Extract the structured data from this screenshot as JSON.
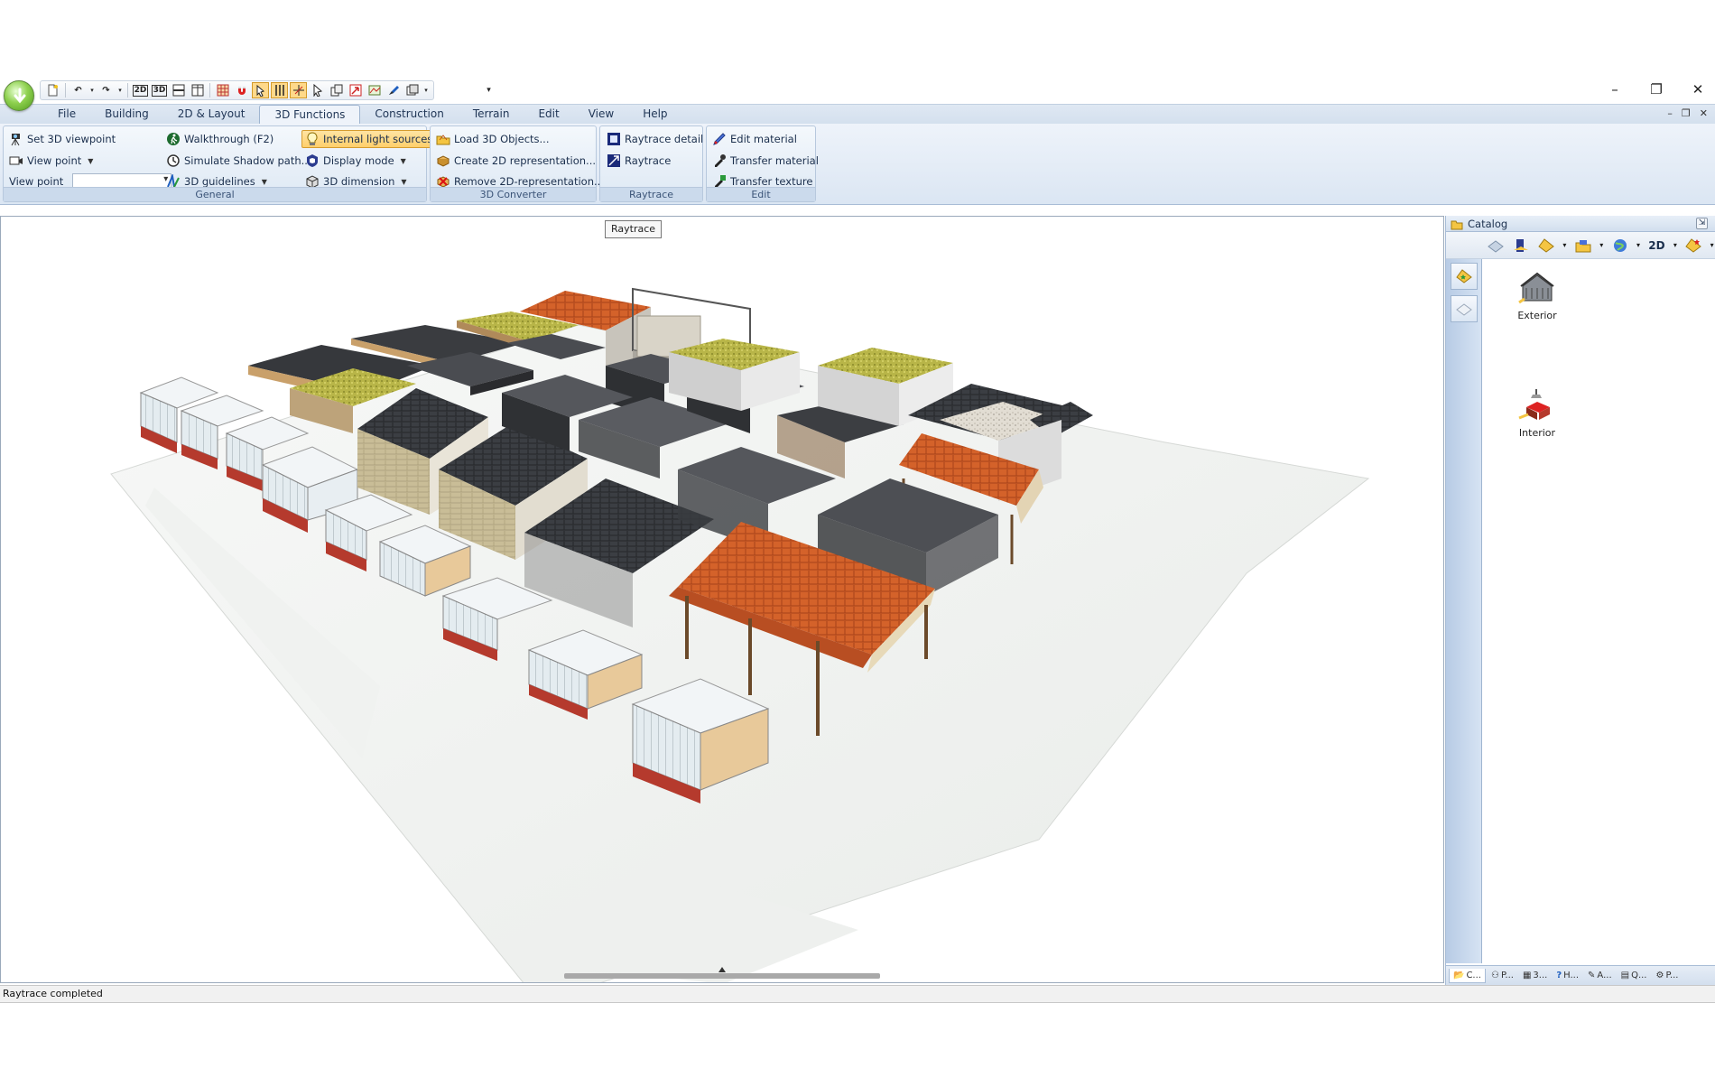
{
  "quick_access": {
    "mode_2d": "2D",
    "mode_3d": "3D"
  },
  "tabs": [
    "File",
    "Building",
    "2D & Layout",
    "3D Functions",
    "Construction",
    "Terrain",
    "Edit",
    "View",
    "Help"
  ],
  "active_tab": "3D Functions",
  "ribbon": {
    "general": {
      "label": "General",
      "set_viewpoint": "Set 3D viewpoint",
      "view_point_menu": "View point",
      "view_point_label": "View point",
      "view_point_value": "",
      "walkthrough": "Walkthrough (F2)",
      "simulate_shadow": "Simulate Shadow path...",
      "guidelines": "3D guidelines",
      "internal_lights": "Internal light sources",
      "display_mode": "Display mode",
      "dimension": "3D dimension"
    },
    "converter": {
      "label": "3D Converter",
      "load_objects": "Load 3D Objects...",
      "create_2d": "Create 2D representation...",
      "remove_2d": "Remove 2D-representation..."
    },
    "raytrace": {
      "label": "Raytrace",
      "detail": "Raytrace detail",
      "raytrace": "Raytrace"
    },
    "edit": {
      "label": "Edit",
      "edit_material": "Edit material",
      "transfer_material": "Transfer material",
      "transfer_texture": "Transfer texture"
    }
  },
  "tooltip": "Raytrace",
  "catalog": {
    "title": "Catalog",
    "toolbar_2d": "2D",
    "items": [
      {
        "label": "Exterior"
      },
      {
        "label": "Interior"
      }
    ],
    "tabs": [
      "C...",
      "P...",
      "3...",
      "H...",
      "A...",
      "Q...",
      "P..."
    ]
  },
  "status": "Raytrace completed"
}
